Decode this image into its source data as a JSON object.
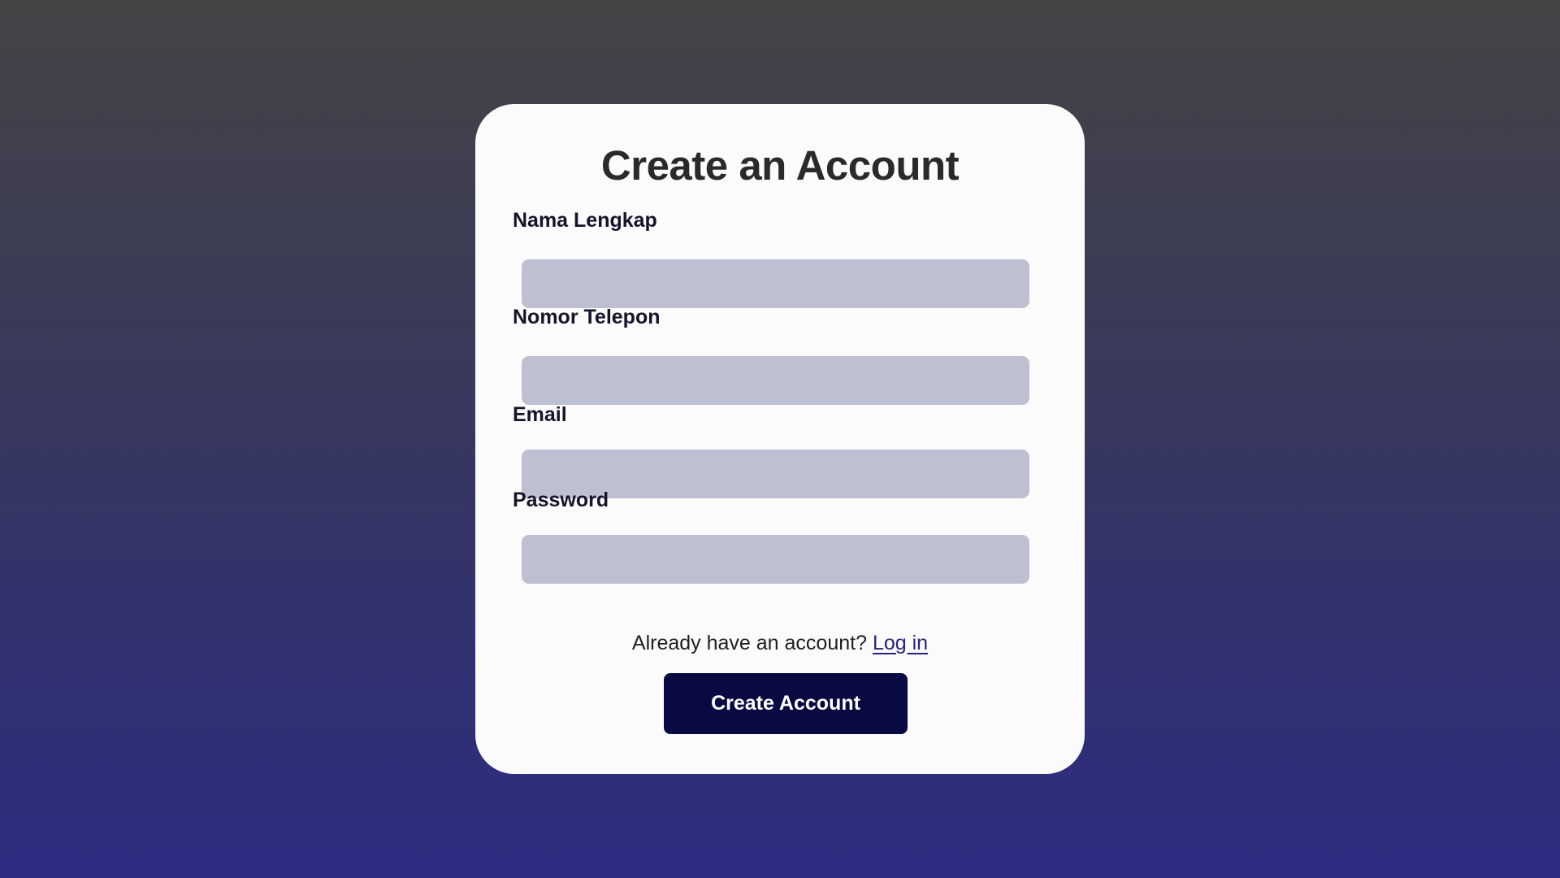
{
  "page": {
    "title": "Create an Account"
  },
  "form": {
    "fields": [
      {
        "label": "Nama Lengkap",
        "value": "",
        "placeholder": ""
      },
      {
        "label": "Nomor Telepon",
        "value": "",
        "placeholder": ""
      },
      {
        "label": "Email",
        "value": "",
        "placeholder": ""
      },
      {
        "label": "Password",
        "value": "",
        "placeholder": ""
      }
    ],
    "login_prompt": "Already have an account?",
    "login_link": "Log in",
    "submit_label": "Create Account"
  },
  "colors": {
    "background_top": "#444446",
    "background_bottom": "#2c2c82",
    "card": "#fbfbfc",
    "input": "#bebfd1",
    "button": "#0a0a42",
    "link": "#25257a"
  }
}
